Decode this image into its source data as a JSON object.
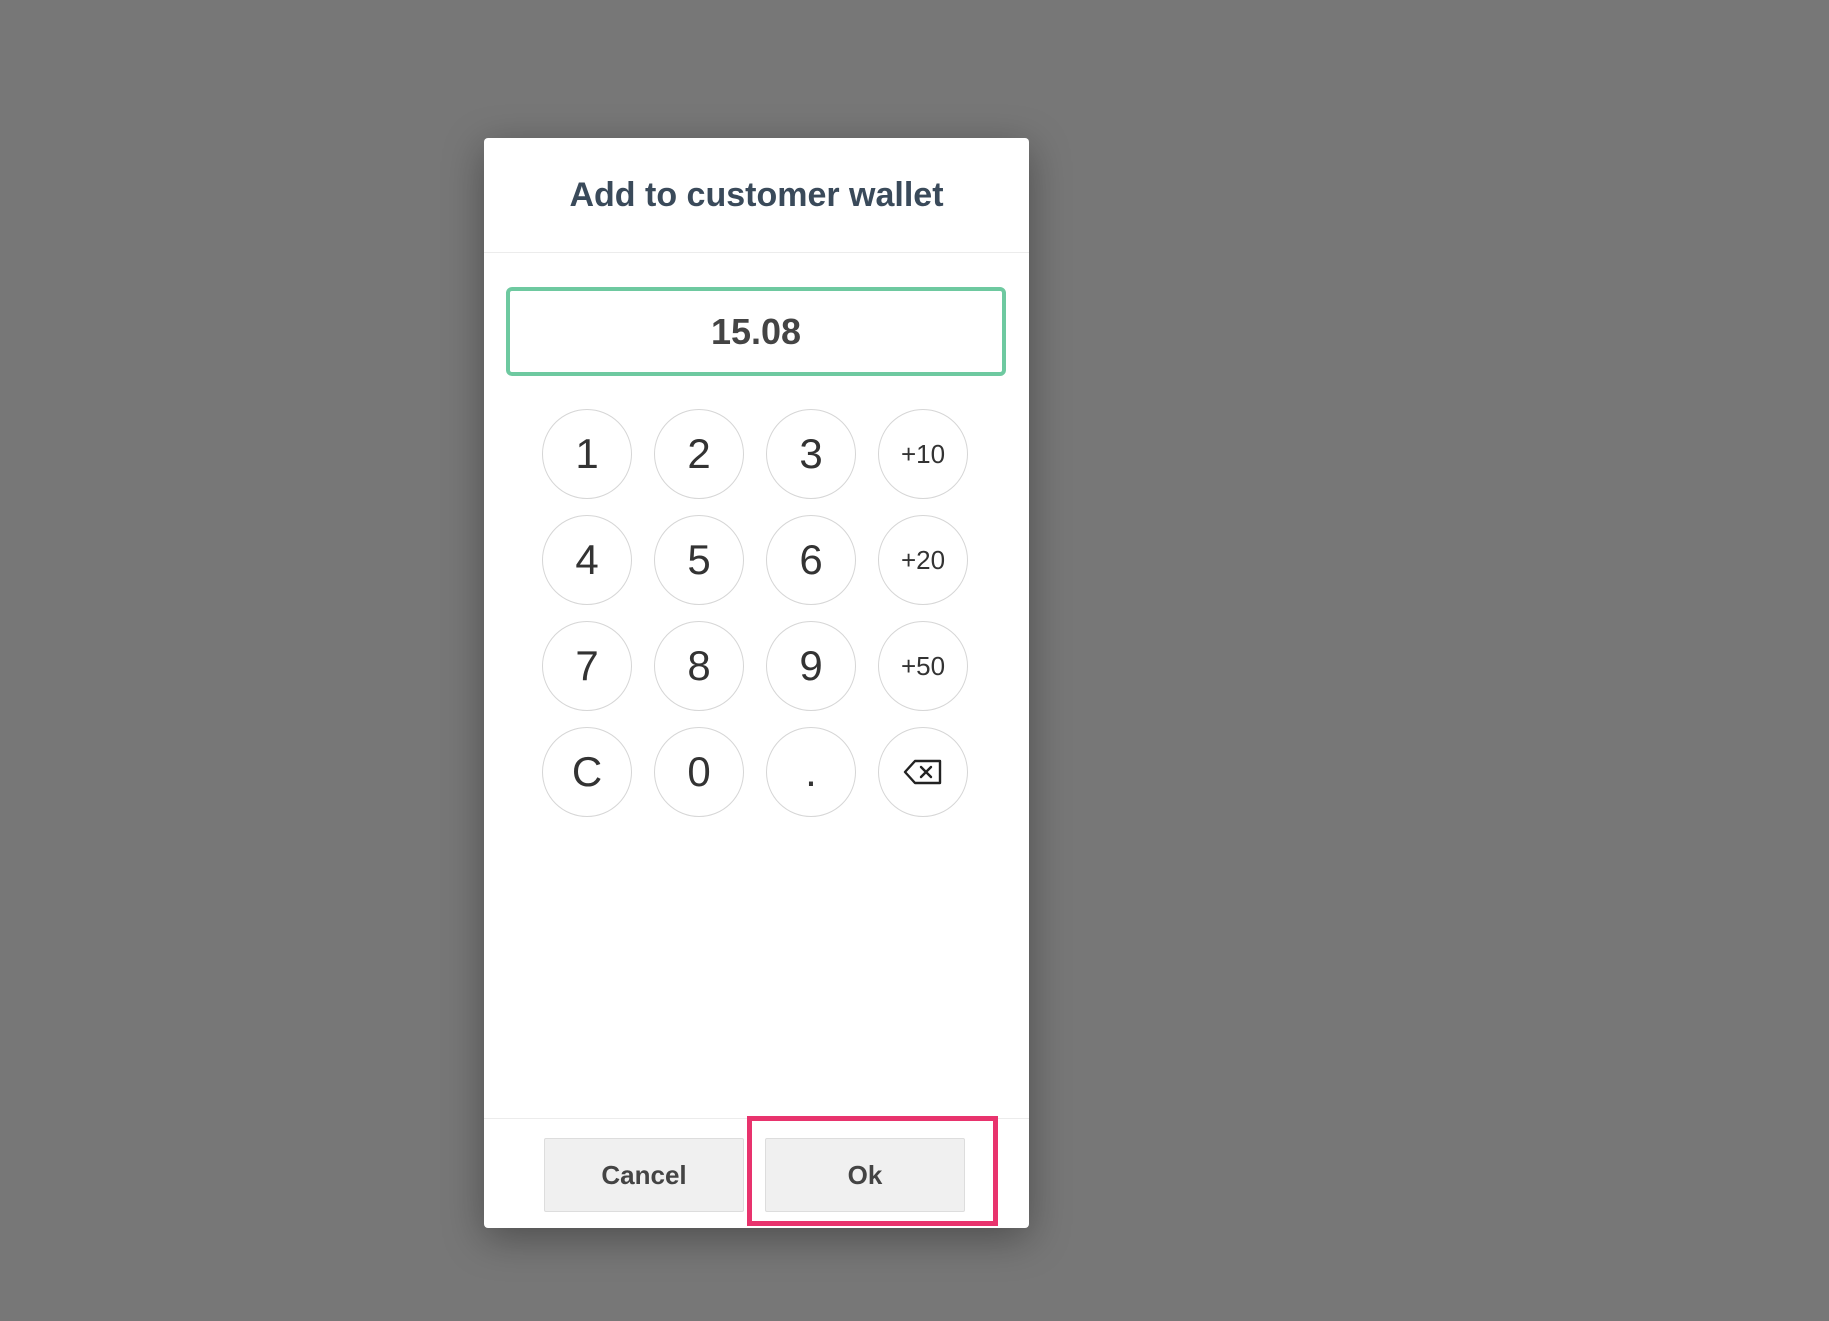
{
  "dialog": {
    "title": "Add to customer wallet",
    "amount": "15.08",
    "accent_color": "#6ec9a0"
  },
  "keypad": {
    "keys": [
      {
        "label": "1",
        "name": "key-1"
      },
      {
        "label": "2",
        "name": "key-2"
      },
      {
        "label": "3",
        "name": "key-3"
      },
      {
        "label": "+10",
        "name": "key-plus-10"
      },
      {
        "label": "4",
        "name": "key-4"
      },
      {
        "label": "5",
        "name": "key-5"
      },
      {
        "label": "6",
        "name": "key-6"
      },
      {
        "label": "+20",
        "name": "key-plus-20"
      },
      {
        "label": "7",
        "name": "key-7"
      },
      {
        "label": "8",
        "name": "key-8"
      },
      {
        "label": "9",
        "name": "key-9"
      },
      {
        "label": "+50",
        "name": "key-plus-50"
      },
      {
        "label": "C",
        "name": "key-clear"
      },
      {
        "label": "0",
        "name": "key-0"
      },
      {
        "label": ".",
        "name": "key-decimal"
      }
    ],
    "backspace_icon": "backspace-icon"
  },
  "footer": {
    "cancel_label": "Cancel",
    "ok_label": "Ok"
  },
  "highlight": {
    "color": "#e8336d"
  }
}
